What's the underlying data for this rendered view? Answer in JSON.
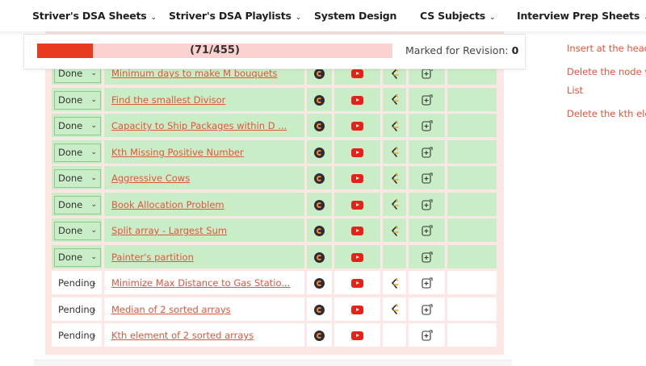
{
  "nav": {
    "items": [
      {
        "label": "Striver's DSA Sheets",
        "has_dropdown": true
      },
      {
        "label": "Striver's DSA Playlists",
        "has_dropdown": true
      },
      {
        "label": "System Design",
        "has_dropdown": false
      },
      {
        "label": "CS Subjects",
        "has_dropdown": true
      },
      {
        "label": "Interview Prep Sheets",
        "has_dropdown": true
      }
    ]
  },
  "progress": {
    "text": "(71/455)",
    "completed": 71,
    "total": 455,
    "revision_label": "Marked for Revision:",
    "revision_count": "0",
    "fill_color": "#e83a20",
    "track_color": "#fbd2cf"
  },
  "side_links": [
    "Insert at the head",
    "Delete the node w",
    "List",
    "Delete the kth ele"
  ],
  "colors": {
    "done_row": "#c9eec7",
    "pending_row": "#ffffff",
    "link": "#e4533a",
    "table_bg": "#fde7e4"
  },
  "rows": [
    {
      "status": "Done",
      "title": "Minimum days to make M bouquets",
      "leetcode": true
    },
    {
      "status": "Done",
      "title": "Find the smallest Divisor",
      "leetcode": true
    },
    {
      "status": "Done",
      "title": "Capacity to Ship Packages within D ...",
      "leetcode": true
    },
    {
      "status": "Done",
      "title": "Kth Missing Positive Number",
      "leetcode": true
    },
    {
      "status": "Done",
      "title": "Aggressive Cows",
      "leetcode": true
    },
    {
      "status": "Done",
      "title": "Book Allocation Problem",
      "leetcode": true
    },
    {
      "status": "Done",
      "title": "Split array - Largest Sum",
      "leetcode": true
    },
    {
      "status": "Done",
      "title": "Painter's partition",
      "leetcode": false
    },
    {
      "status": "Pending",
      "title": "Minimize Max Distance to Gas Statio...",
      "leetcode": true
    },
    {
      "status": "Pending",
      "title": "Median of 2 sorted arrays",
      "leetcode": true
    },
    {
      "status": "Pending",
      "title": "Kth element of 2 sorted arrays",
      "leetcode": false
    }
  ],
  "icons": {
    "col1": "codingninjas-icon",
    "col2": "youtube-icon",
    "col3": "leetcode-icon",
    "col4": "add-note-icon",
    "dropdown": "chevron-down-icon"
  }
}
